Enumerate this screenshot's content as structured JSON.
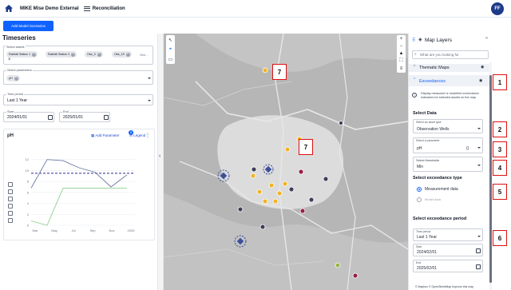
{
  "topbar": {
    "app_name": "MIKE Mise Demo External",
    "page_name": "Reconciliation",
    "avatar_initials": "FF"
  },
  "toolbar": {
    "add_model_scenarios": "Add Model Scenarios"
  },
  "timeseries": {
    "title": "Timeseries",
    "select_assets": {
      "label": "Select assets",
      "chips": [
        "Rainfall Station 1",
        "Rainfall Station 3",
        "Obs_3",
        "Obs_15"
      ],
      "see_more": "See..."
    },
    "select_parameters": {
      "label": "Select parameters",
      "chips": [
        "pH"
      ]
    },
    "time_period": {
      "label": "Time period",
      "value": "Last 1 Year"
    },
    "start": {
      "label": "Start",
      "value": "2024/01/01"
    },
    "end": {
      "label": "End",
      "value": "2025/01/01"
    },
    "chart": {
      "title": "pH",
      "add_parameter": "Add Parameter",
      "legend": "Legend",
      "legend_badge": "8"
    }
  },
  "chart_data": {
    "type": "line",
    "title": "pH",
    "xlabel": "",
    "ylabel": "",
    "categories": [
      "Mar",
      "May",
      "Jul",
      "Sep",
      "Nov",
      "2025"
    ],
    "yticks": [
      0,
      2,
      4,
      6,
      8,
      10,
      12
    ],
    "ylim": [
      0,
      14
    ],
    "threshold": 9.5,
    "series": [
      {
        "values": [
          6.8,
          12.0,
          11.8,
          10.5,
          9.7,
          7.0,
          9.2
        ],
        "color": "#6b7aa1"
      },
      {
        "values": [
          0.8,
          0.0,
          6.8,
          6.8,
          6.8,
          6.8,
          6.8
        ],
        "color": "#8fcf8f"
      }
    ]
  },
  "map": {
    "callouts": [
      "7",
      "7"
    ],
    "attribution": "© Mapbox © OpenStreetMap Improve this map"
  },
  "map_layers": {
    "title": "Map Layers",
    "search_placeholder": "What are you looking for",
    "thematic_maps": "Thematic Maps",
    "exceedances": "Exceedances",
    "info": "Display measured or modelled exceedance indicators for selected assets on the map",
    "select_data": "Select Data",
    "asset_type_label": "Select an asset type",
    "asset_type_value": "Observation Wells",
    "parameter_label": "Select a parameter",
    "parameter_value": "pH",
    "parameter_suffix": "()",
    "thresholds_label": "Select thresholds",
    "thresholds_value": "Min",
    "exceedance_type_title": "Select exceedance type",
    "measurement_data": "Measurement data",
    "model_data": "Model data",
    "exceedance_period_title": "Select exceedance period",
    "time_period_label": "Time period",
    "time_period_value": "Last 1 Year",
    "start_label": "Start",
    "start_value": "2024/02/01",
    "end_label": "End",
    "end_value": "2025/02/01",
    "callouts": [
      "1",
      "2",
      "3",
      "4",
      "5",
      "6"
    ]
  },
  "colors": {
    "accent": "#0f62fe",
    "brand": "#1e3a8a",
    "callout_border": "#dd1111",
    "threshold": "#2a2a8a"
  }
}
